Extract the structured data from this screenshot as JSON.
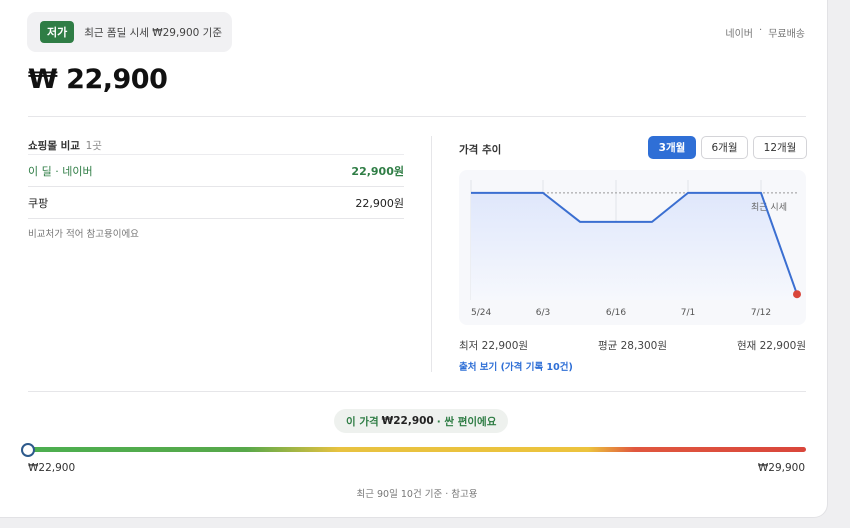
{
  "header": {
    "badge": "저가",
    "reference_text": "최근 폼딜 시세 ₩29,900 기준",
    "source": [
      "네이버",
      "·",
      "무료배송"
    ]
  },
  "price": "₩ 22,900",
  "compare": {
    "title": "쇼핑몰 비교",
    "count": "1곳",
    "rows": [
      {
        "name": "이 딜 · 네이버",
        "price": "22,900원"
      },
      {
        "name": "쿠팡",
        "price": "22,900원"
      }
    ],
    "note": "비교처가 적어 참고용이에요"
  },
  "trend": {
    "title": "가격 추이",
    "tabs": [
      {
        "label": "3개월",
        "active": true
      },
      {
        "label": "6개월",
        "active": false
      },
      {
        "label": "12개월",
        "active": false
      }
    ],
    "stats": {
      "min": "최저 22,900원",
      "avg": "평균 28,300원",
      "current": "현재 22,900원"
    },
    "source_link": "출처 보기 (가격 기록 10건)"
  },
  "chart_data": {
    "type": "line",
    "x": [
      "5/24",
      "6/3",
      "6/8",
      "6/16",
      "6/24",
      "7/1",
      "7/12",
      "7/17"
    ],
    "x_ticks": [
      "5/24",
      "6/3",
      "6/16",
      "7/1",
      "7/12"
    ],
    "series": [
      {
        "values": [
          29900,
          29900,
          27900,
          27900,
          27900,
          29900,
          29900,
          22900
        ]
      }
    ],
    "reference_line": {
      "value": 29900,
      "label": "최근 시세"
    },
    "ylim": [
      22500,
      30100
    ],
    "grid": true,
    "colors": {
      "line": "#3b6fd1",
      "fill": "#e3eafb",
      "last_point": "#d9463b",
      "reference": "#999999"
    }
  },
  "verdict": {
    "prefix": "이 가격",
    "price": "₩22,900",
    "suffix": "· 싼 편이에요"
  },
  "range": {
    "min_label": "₩22,900",
    "max_label": "₩29,900",
    "position": 0,
    "note": "최근 90일 10건 기준 · 참고용"
  }
}
